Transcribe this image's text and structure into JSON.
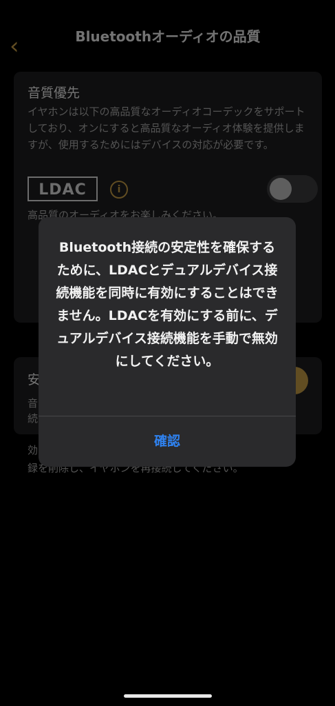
{
  "header": {
    "title": "Bluetoothオーディオの品質",
    "back_icon": "chevron-left-icon"
  },
  "card_quality": {
    "title": "音質優先",
    "description": "イヤホンは以下の高品質なオーディオコーデックをサポートしており、オンにすると高品質なオーディオ体験を提供しますが、使用するためにはデバイスの対応が必要です。",
    "codec_logo": "LDAC",
    "info_icon": "info-icon",
    "toggle_on": false,
    "sub_text": "高品質のオーディオをお楽しみください。"
  },
  "card_stable": {
    "title": "安",
    "desc_line1": "音",
    "desc_line2": "続",
    "toggle_on": true
  },
  "footnote": "効\n録を削除し、イヤホンを再接続してください。",
  "alert": {
    "message": "Bluetooth接続の安定性を確保するために、LDACとデュアルデバイス接続機能を同時に有効にすることはできません。LDACを有効にする前に、デュアルデバイス接続機能を手動で無効にしてください。",
    "confirm_label": "確認"
  },
  "colors": {
    "accent": "#c39a45",
    "link_blue": "#2f82f0",
    "card_bg": "#1c1c1e",
    "alert_bg": "#2a2a2c"
  }
}
